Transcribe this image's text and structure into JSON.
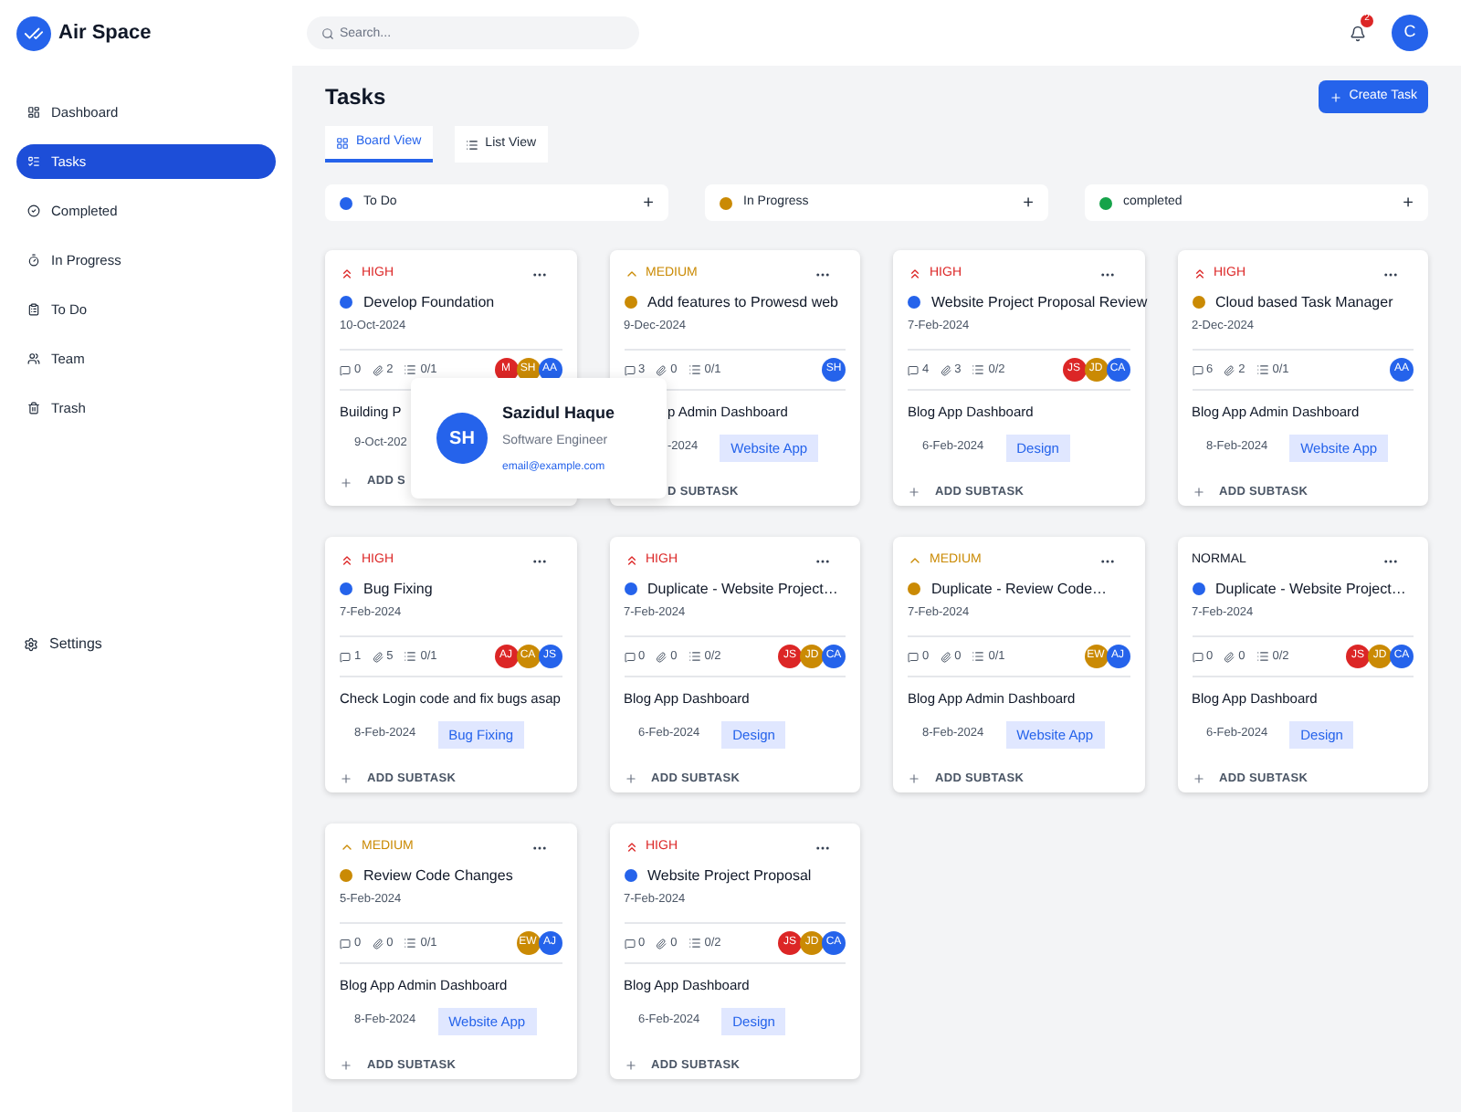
{
  "brand": {
    "name": "Air Space"
  },
  "search": {
    "placeholder": "Search..."
  },
  "notifications": {
    "count": "2"
  },
  "user": {
    "initial": "C"
  },
  "sidebar": {
    "items": [
      {
        "label": "Dashboard",
        "selected": false
      },
      {
        "label": "Tasks",
        "selected": true
      },
      {
        "label": "Completed",
        "selected": false
      },
      {
        "label": "In Progress",
        "selected": false
      },
      {
        "label": "To Do",
        "selected": false
      },
      {
        "label": "Team",
        "selected": false
      },
      {
        "label": "Trash",
        "selected": false
      }
    ],
    "settings": "Settings"
  },
  "page_title": "Tasks",
  "create_button": "Create Task",
  "tabs": [
    {
      "label": "Board View",
      "selected": true
    },
    {
      "label": "List View",
      "selected": false
    }
  ],
  "columns": [
    {
      "label": "To Do",
      "color": "#2563eb",
      "add": "+"
    },
    {
      "label": "In Progress",
      "color": "#ca8a04",
      "add": "+"
    },
    {
      "label": "completed",
      "color": "#16a34a",
      "add": "+"
    }
  ],
  "cards": [
    {
      "priority": "HIGH",
      "kind": "high",
      "title": "Develop Foundation",
      "color": "#2563eb",
      "date": "10-Oct-2024",
      "comments": "0",
      "attachments": "2",
      "subtasks": "0/1",
      "avatars": [
        {
          "initials": "M",
          "color": "#dc2626"
        },
        {
          "initials": "SH",
          "color": "#ca8a04"
        },
        {
          "initials": "AA",
          "color": "#2563eb"
        }
      ],
      "subtask_title": "Building P",
      "subtask_date": "9-Oct-202",
      "add_label": "ADD S"
    },
    {
      "priority": "MEDIUM",
      "kind": "medium",
      "title": "Add features to Prowesd web",
      "color": "#ca8a04",
      "date": "9-Dec-2024",
      "comments": "3",
      "attachments": "0",
      "subtasks": "0/1",
      "avatars": [
        {
          "initials": "SH",
          "color": "#2563eb"
        }
      ],
      "subtask_title": "p Admin Dashboard",
      "subtask_date": "-2024",
      "tag": "Website App",
      "add_label": "D SUBTASK"
    },
    {
      "priority": "HIGH",
      "kind": "high",
      "title": "Website Project Proposal Review",
      "color": "#2563eb",
      "date": "7-Feb-2024",
      "comments": "4",
      "attachments": "3",
      "subtasks": "0/2",
      "avatars": [
        {
          "initials": "JS",
          "color": "#dc2626"
        },
        {
          "initials": "JD",
          "color": "#ca8a04"
        },
        {
          "initials": "CA",
          "color": "#2563eb"
        }
      ],
      "subtask_title": "Blog App Dashboard",
      "subtask_date": "6-Feb-2024",
      "tag": "Design",
      "add_label": "ADD SUBTASK"
    },
    {
      "priority": "HIGH",
      "kind": "high",
      "title": "Cloud based Task Manager",
      "color": "#ca8a04",
      "date": "2-Dec-2024",
      "comments": "6",
      "attachments": "2",
      "subtasks": "0/1",
      "avatars": [
        {
          "initials": "AA",
          "color": "#2563eb"
        }
      ],
      "subtask_title": "Blog App Admin Dashboard",
      "subtask_date": "8-Feb-2024",
      "tag": "Website App",
      "add_label": "ADD SUBTASK"
    },
    {
      "priority": "HIGH",
      "kind": "high",
      "title": "Bug Fixing",
      "color": "#2563eb",
      "date": "7-Feb-2024",
      "comments": "1",
      "attachments": "5",
      "subtasks": "0/1",
      "avatars": [
        {
          "initials": "AJ",
          "color": "#dc2626"
        },
        {
          "initials": "CA",
          "color": "#ca8a04"
        },
        {
          "initials": "JS",
          "color": "#2563eb"
        }
      ],
      "subtask_title": "Check Login code and fix bugs asap",
      "subtask_date": "8-Feb-2024",
      "tag": "Bug Fixing",
      "add_label": "ADD SUBTASK"
    },
    {
      "priority": "HIGH",
      "kind": "high",
      "title": "Duplicate - Website Project…",
      "color": "#2563eb",
      "date": "7-Feb-2024",
      "comments": "0",
      "attachments": "0",
      "subtasks": "0/2",
      "avatars": [
        {
          "initials": "JS",
          "color": "#dc2626"
        },
        {
          "initials": "JD",
          "color": "#ca8a04"
        },
        {
          "initials": "CA",
          "color": "#2563eb"
        }
      ],
      "subtask_title": "Blog App Dashboard",
      "subtask_date": "6-Feb-2024",
      "tag": "Design",
      "add_label": "ADD SUBTASK"
    },
    {
      "priority": "MEDIUM",
      "kind": "medium",
      "title": "Duplicate - Review Code…",
      "color": "#ca8a04",
      "date": "7-Feb-2024",
      "comments": "0",
      "attachments": "0",
      "subtasks": "0/1",
      "avatars": [
        {
          "initials": "EW",
          "color": "#ca8a04"
        },
        {
          "initials": "AJ",
          "color": "#2563eb"
        }
      ],
      "subtask_title": "Blog App Admin Dashboard",
      "subtask_date": "8-Feb-2024",
      "tag": "Website App",
      "add_label": "ADD SUBTASK"
    },
    {
      "priority": "NORMAL",
      "kind": "normal",
      "title": "Duplicate - Website Project…",
      "color": "#2563eb",
      "date": "7-Feb-2024",
      "comments": "0",
      "attachments": "0",
      "subtasks": "0/2",
      "avatars": [
        {
          "initials": "JS",
          "color": "#dc2626"
        },
        {
          "initials": "JD",
          "color": "#ca8a04"
        },
        {
          "initials": "CA",
          "color": "#2563eb"
        }
      ],
      "subtask_title": "Blog App Dashboard",
      "subtask_date": "6-Feb-2024",
      "tag": "Design",
      "add_label": "ADD SUBTASK"
    },
    {
      "priority": "MEDIUM",
      "kind": "medium",
      "title": "Review Code Changes",
      "color": "#ca8a04",
      "date": "5-Feb-2024",
      "comments": "0",
      "attachments": "0",
      "subtasks": "0/1",
      "avatars": [
        {
          "initials": "EW",
          "color": "#ca8a04"
        },
        {
          "initials": "AJ",
          "color": "#2563eb"
        }
      ],
      "subtask_title": "Blog App Admin Dashboard",
      "subtask_date": "8-Feb-2024",
      "tag": "Website App",
      "add_label": "ADD SUBTASK"
    },
    {
      "priority": "HIGH",
      "kind": "high",
      "title": "Website Project Proposal",
      "color": "#2563eb",
      "date": "7-Feb-2024",
      "comments": "0",
      "attachments": "0",
      "subtasks": "0/2",
      "avatars": [
        {
          "initials": "JS",
          "color": "#dc2626"
        },
        {
          "initials": "JD",
          "color": "#ca8a04"
        },
        {
          "initials": "CA",
          "color": "#2563eb"
        }
      ],
      "subtask_title": "Blog App Dashboard",
      "subtask_date": "6-Feb-2024",
      "tag": "Design",
      "add_label": "ADD SUBTASK"
    }
  ],
  "user_popover": {
    "initials": "SH",
    "name": "Sazidul Haque",
    "role": "Software Engineer",
    "email": "email@example.com"
  }
}
